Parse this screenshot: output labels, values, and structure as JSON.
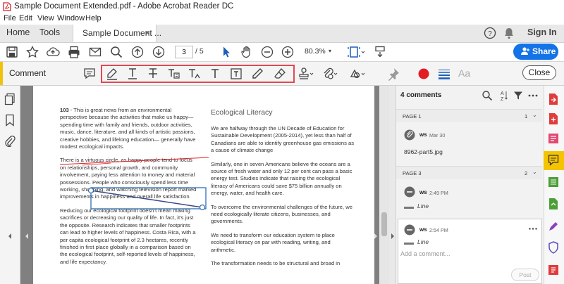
{
  "window": {
    "title": "Sample Document Extended.pdf - Adobe Acrobat Reader DC"
  },
  "menu": [
    "File",
    "Edit",
    "View",
    "Window",
    "Help"
  ],
  "nav": {
    "home": "Home",
    "tools": "Tools",
    "doc_tab": "Sample Document ...",
    "close_tab": "×",
    "sign_in": "Sign In"
  },
  "toolbar": {
    "page_current": "3",
    "page_total": "/  5",
    "zoom": "80.3%",
    "share": "Share"
  },
  "comment_bar": {
    "label": "Comment",
    "close": "Close",
    "text_sample": "Aa"
  },
  "document": {
    "left_col": [
      {
        "lead": "103",
        "text": " - This is great news from an environmental perspective because the activities that make us happy—spending time with family and friends, outdoor activities, music, dance, literature, and all kinds of artistic passions, creative hobbies, and lifelong education— generally have modest ecological impacts."
      },
      {
        "lead": "",
        "text": "There is a virtuous circle, as happy people tend to focus on relationships, personal growth, and community involvement, paying less attention to money and material possessions. People who consciously spend less time working, shopping, and watching television report marked improvements in happiness and overall life satisfaction."
      },
      {
        "lead": "",
        "text": "Reducing our ecological footprint doesn’t mean making sacrifices or decreasing our quality of life. In fact, it’s just the opposite. Research indicates that smaller footprints can lead to higher levels of happiness. Costa Rica, with a per capita ecological footprint of 2.3 hectares, recently finished in first place globally in a comparison based on the ecological footprint, self-reported levels of happiness, and life expectancy."
      }
    ],
    "right_title": "Ecological Literacy",
    "right_col": [
      "We are halfway through the UN Decade of Education for Sustainable Development (2005-2014), yet less than half of Canadians are able to identify greenhouse gas emissions as a cause of climate change",
      "Similarly, one in seven Americans believe the oceans are a source of fresh water and only 12 per cent can pass a basic energy test. Studies indicate that raising the ecological literacy of Americans could save $75 billion annually on energy, water, and health care.",
      "To overcome the environmental challenges of the future, we need ecologically literate citizens, businesses, and governments.",
      "We need to transform our education system to place ecological literacy on par with reading, writing, and arithmetic.",
      "The transformation needs to be structural and broad in"
    ]
  },
  "comments_panel": {
    "count": "4 comments",
    "sort_label": "A Z",
    "groups": [
      {
        "page": "PAGE 1",
        "n": "1",
        "items": [
          {
            "user": "ws",
            "date": "Mar 30",
            "text": "8962-part5.jpg"
          }
        ]
      },
      {
        "page": "PAGE 3",
        "n": "2",
        "items": [
          {
            "user": "ws",
            "date": "2:49 PM",
            "text": "Line"
          },
          {
            "user": "ws",
            "date": "2:54 PM",
            "text": "Line"
          }
        ]
      }
    ],
    "add_comment": "Add a comment...",
    "post": "Post"
  },
  "colors": {
    "accent": "#1473e6",
    "comment_yellow": "#f0c20e",
    "highlight_red": "#e34850",
    "record_red": "#e31b23",
    "annotation_blue": "#2d6db5"
  }
}
